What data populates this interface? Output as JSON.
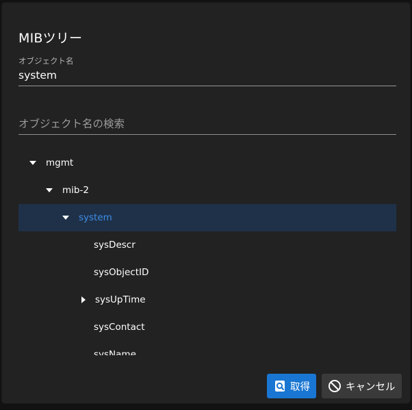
{
  "dialog": {
    "title": "MIBツリー"
  },
  "object_name": {
    "label": "オブジェクト名",
    "value": "system"
  },
  "search": {
    "placeholder": "オブジェクト名の検索",
    "value": ""
  },
  "tree": {
    "items": [
      {
        "label": "mgmt",
        "expanded": true,
        "selected": false
      },
      {
        "label": "mib-2",
        "expanded": true,
        "selected": false
      },
      {
        "label": "system",
        "expanded": true,
        "selected": true
      },
      {
        "label": "sysDescr",
        "selected": false
      },
      {
        "label": "sysObjectID",
        "selected": false
      },
      {
        "label": "sysUpTime",
        "expanded": false,
        "selected": false
      },
      {
        "label": "sysContact",
        "selected": false
      },
      {
        "label": "sysName",
        "selected": false
      }
    ]
  },
  "buttons": {
    "get_label": "取得",
    "cancel_label": "キャンセル"
  },
  "colors": {
    "dialog_bg": "#222222",
    "selected_bg": "#1f3149",
    "selected_text": "#3b8ee8",
    "primary": "#1976d2",
    "cancel_bg": "#3a3a3a"
  },
  "icons": {
    "get": "search-document-icon",
    "cancel": "block-icon",
    "expanded": "caret-down-icon",
    "collapsed": "caret-right-icon"
  }
}
